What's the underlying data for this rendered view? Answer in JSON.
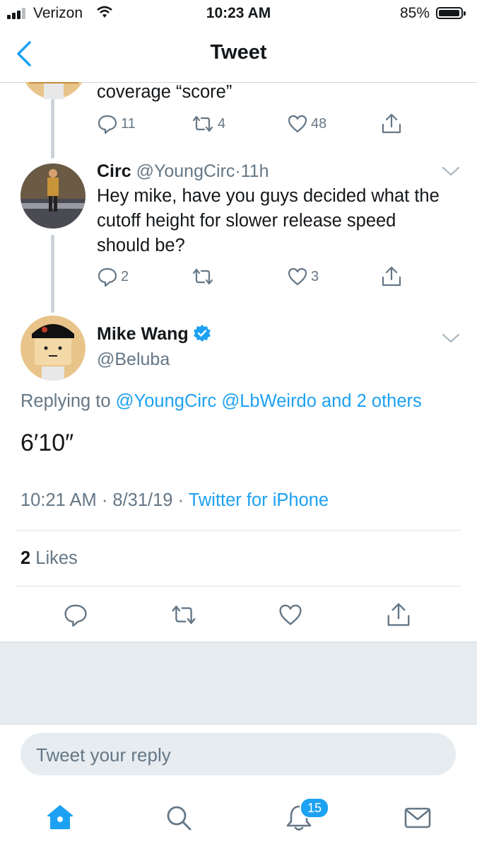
{
  "status_bar": {
    "carrier": "Verizon",
    "time": "10:23 AM",
    "battery": "85%"
  },
  "header": {
    "title": "Tweet"
  },
  "prev_tweet": {
    "text_tail": "coverage “score”",
    "actions": {
      "replies": "11",
      "retweets": "4",
      "likes": "48"
    }
  },
  "reply_tweet": {
    "name": "Circ",
    "handle": "@YoungCirc",
    "time": "11h",
    "text": "Hey mike, have you guys decided what the cutoff height for slower release speed should be?",
    "actions": {
      "replies": "2",
      "retweets": "",
      "likes": "3"
    }
  },
  "main_tweet": {
    "name": "Mike Wang",
    "handle": "@Beluba",
    "replying_label": "Replying to",
    "replying_mentions": "@YoungCirc @LbWeirdo and 2 others",
    "text": "6′10″",
    "timestamp": "10:21 AM · 8/31/19 ·",
    "source": "Twitter for iPhone",
    "likes_count": "2",
    "likes_label": "Likes"
  },
  "reply_composer": {
    "placeholder": "Tweet your reply"
  },
  "tab_bar": {
    "notifications_badge": "15"
  },
  "colors": {
    "accent": "#1da1f2",
    "secondary_text": "#657786",
    "background_gray": "#e6ecf0"
  },
  "icons": [
    "back-chevron-icon",
    "reply-icon",
    "retweet-icon",
    "like-icon",
    "share-icon",
    "verified-icon",
    "home-icon",
    "search-icon",
    "notifications-icon",
    "messages-icon",
    "caret-down-icon"
  ]
}
